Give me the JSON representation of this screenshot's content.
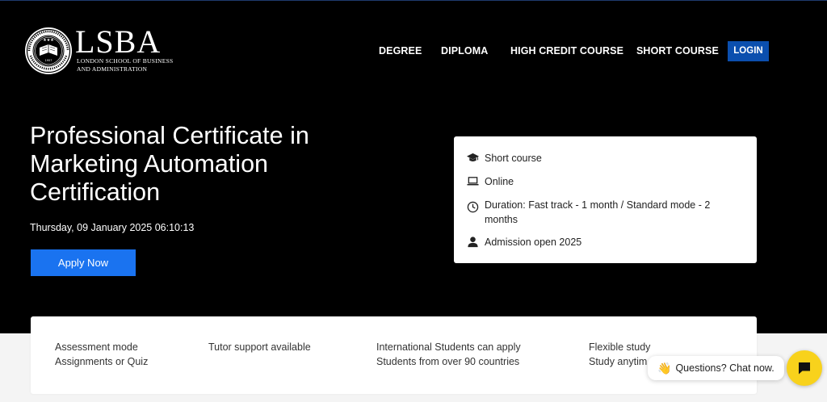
{
  "brand": {
    "name": "LSBA",
    "subtitle_line1": "LONDON SCHOOL OF BUSINESS",
    "subtitle_line2": "AND ADMINISTRATION"
  },
  "nav": {
    "items": [
      "DEGREE",
      "DIPLOMA",
      "HIGH CREDIT COURSE",
      "SHORT COURSE"
    ],
    "login_label": "LOGIN"
  },
  "hero": {
    "title": "Professional Certificate in Marketing Automation Certification",
    "datetime": "Thursday, 09 January 2025 06:10:13",
    "apply_label": "Apply Now"
  },
  "info": {
    "course_type": "Short course",
    "mode": "Online",
    "duration": "Duration: Fast track - 1 month / Standard mode - 2 months",
    "admission": "Admission open 2025"
  },
  "features": [
    {
      "line1": "Assessment mode",
      "line2": "Assignments or Quiz"
    },
    {
      "line1": "Tutor support available",
      "line2": ""
    },
    {
      "line1": "International Students can apply",
      "line2": "Students from over 90 countries"
    },
    {
      "line1": "Flexible study",
      "line2": "Study anytim"
    }
  ],
  "chat": {
    "prompt": "Questions? Chat now."
  },
  "icons": {
    "course_type": "graduation-cap-icon",
    "mode": "laptop-icon",
    "duration": "clock-icon",
    "admission": "user-icon",
    "chat": "chat-bubble-icon",
    "wave": "waving-hand-icon"
  },
  "colors": {
    "hero_bg": "#000000",
    "login_bg": "#0b4fae",
    "apply_bg": "#1a73f0",
    "chat_fab": "#f8d21c"
  }
}
